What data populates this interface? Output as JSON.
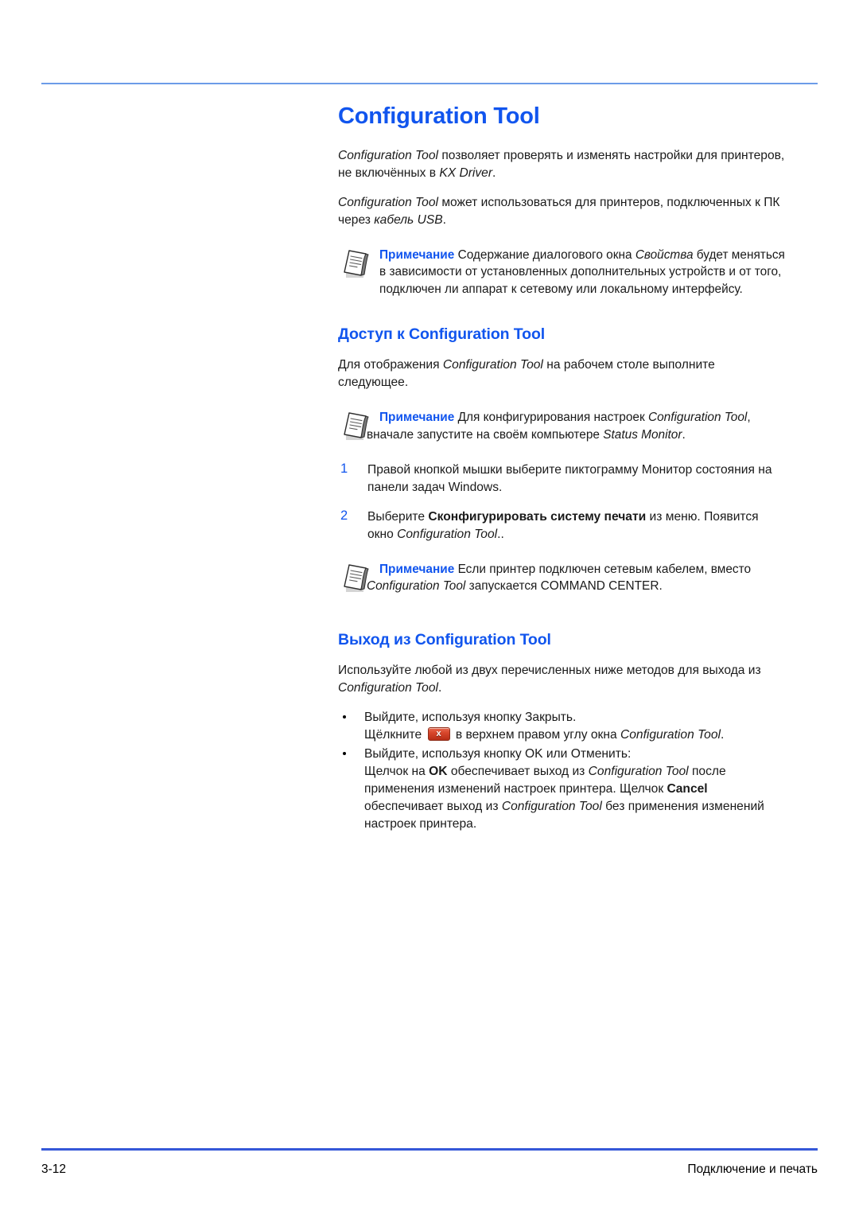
{
  "document": {
    "title": "Configuration Tool",
    "title_color": "#1155ee",
    "rule_top_color": "#6c9ce8",
    "rule_bottom_color": "#3558d8"
  },
  "intro": {
    "para1_a": "Configuration Tool",
    "para1_b": " позволяет проверять и изменять настройки для принтеров, не включённых в ",
    "para1_c": "KX Driver",
    "para1_d": ".",
    "para2_a": "Configuration Tool",
    "para2_b": " может использоваться для принтеров, подключенных к ПК через ",
    "para2_c": "кабель USB",
    "para2_d": "."
  },
  "note1": {
    "icon": "note-document-icon",
    "label": "Примечание",
    "text_a": " Содержание диалогового окна ",
    "text_b": "Свойства",
    "text_c": " будет меняться в зависимости от установленных дополнительных устройств и от того, подключен ли аппарат к сетевому или локальному интерфейсу."
  },
  "section_access": {
    "heading": "Доступ к Configuration Tool",
    "para_a": "Для отображения ",
    "para_b": "Configuration Tool",
    "para_c": " на рабочем столе выполните следующее."
  },
  "note2": {
    "icon": "note-document-icon",
    "label": "Примечание",
    "text_a": " Для конфигурирования настроек ",
    "text_b": "Configuration Tool",
    "text_c": ", вначале запустите на своём компьютере ",
    "text_d": "Status Monitor",
    "text_e": "."
  },
  "steps": [
    {
      "number": "1",
      "text_a": "Правой кнопкой мышки выберите пиктограмму Монитор состояния на панели задач Windows."
    },
    {
      "number": "2",
      "text_a": "Выберите ",
      "text_bold": "Сконфигурировать систему печати",
      "text_b": " из меню. Появится окно ",
      "text_italic": "Configuration Tool",
      "text_c": ".."
    }
  ],
  "note3": {
    "icon": "note-document-icon",
    "label": "Примечание",
    "text_a": " Если принтер подключен сетевым кабелем, вместо ",
    "text_b": "Configuration Tool",
    "text_c": " запускается COMMAND CENTER."
  },
  "section_exit": {
    "heading": "Выход из  Configuration Tool",
    "para_a": "Используйте любой из двух перечисленных ниже методов для выхода из ",
    "para_b": "Configuration Tool",
    "para_c": "."
  },
  "bullets": [
    {
      "line1": "Выйдите, используя кнопку Закрыть.",
      "line2_a": "Щёлкните ",
      "icon": "window-close-button-icon",
      "icon_glyph": "x",
      "line2_b": " в верхнем правом углу окна  ",
      "line2_italic": "Configuration Tool",
      "line2_c": "."
    },
    {
      "line1": "Выйдите, используя кнопку OK или Отменить:",
      "line2_a": "Щелчок на ",
      "line2_bold1": "OK",
      "line2_b": " обеспечивает выход из ",
      "line2_italic1": "Configuration Tool",
      "line2_c": " после применения изменений настроек принтера. Щелчок ",
      "line2_bold2": "Cancel",
      "line2_d": " обеспечивает выход из  ",
      "line2_italic2": "Configuration Tool",
      "line2_e": " без применения изменений настроек принтера."
    }
  ],
  "footer": {
    "page_number": "3-12",
    "section_name": "Подключение и печать"
  }
}
